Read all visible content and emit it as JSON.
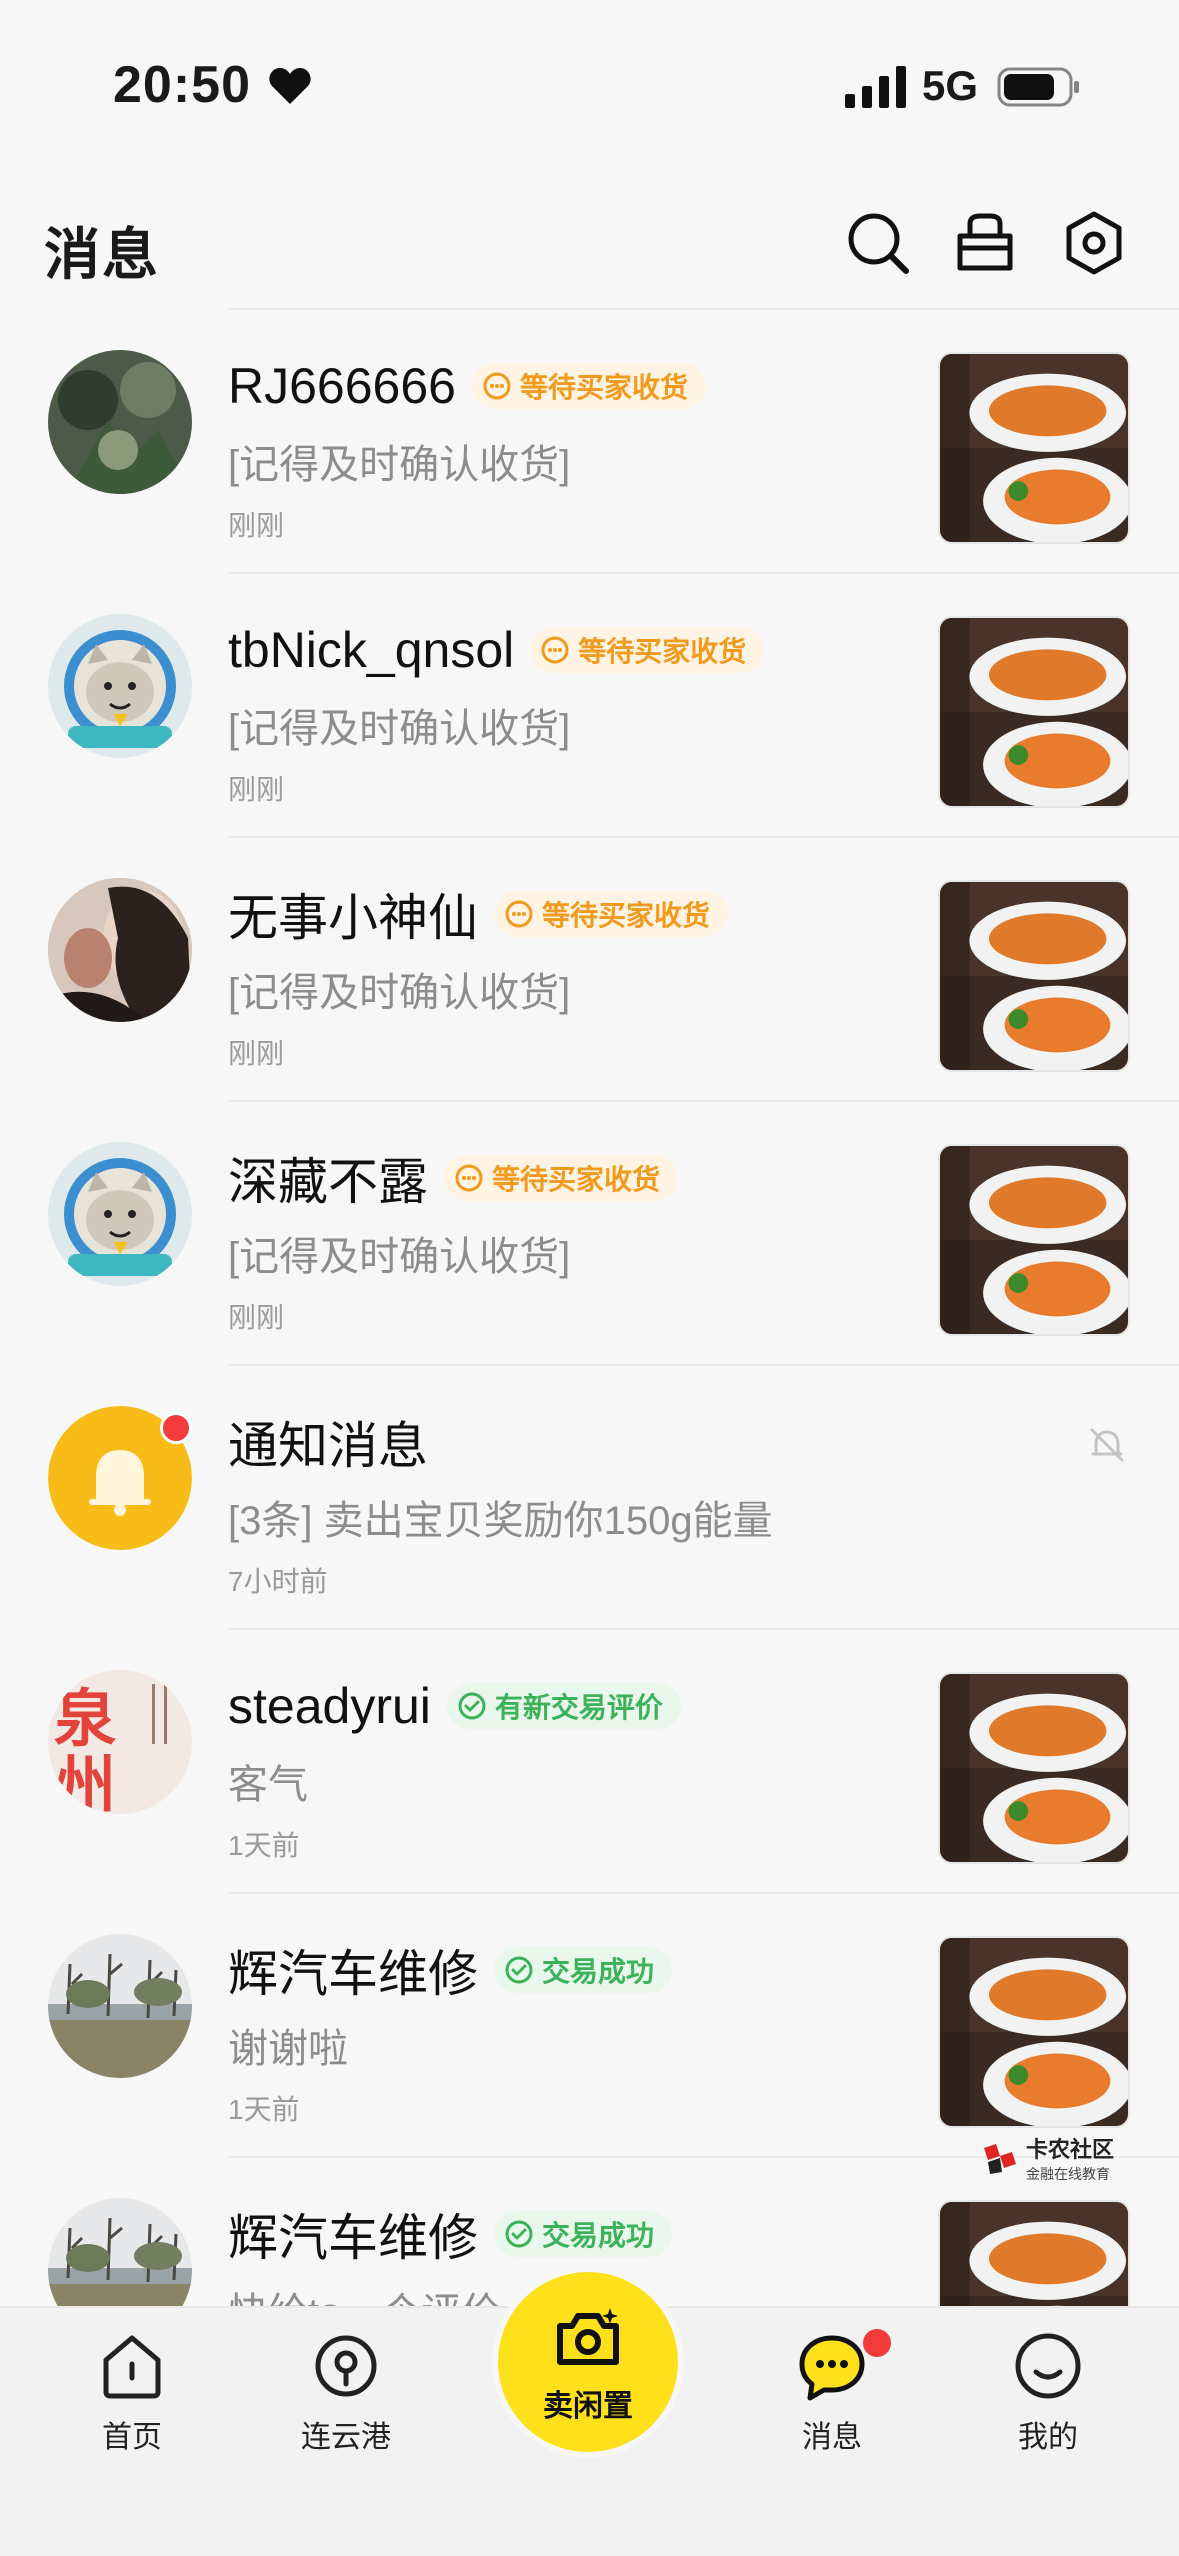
{
  "status_bar": {
    "time": "20:50",
    "network": "5G"
  },
  "header": {
    "title": "消息"
  },
  "messages": [
    {
      "name": "RJ666666",
      "tag": "等待买家收货",
      "tag_color": "orange",
      "preview": "[记得及时确认收货]",
      "time": "刚刚"
    },
    {
      "name": "tbNick_qnsol",
      "tag": "等待买家收货",
      "tag_color": "orange",
      "preview": "[记得及时确认收货]",
      "time": "刚刚"
    },
    {
      "name": "无事小神仙",
      "tag": "等待买家收货",
      "tag_color": "orange",
      "preview": "[记得及时确认收货]",
      "time": "刚刚"
    },
    {
      "name": "深藏不露",
      "tag": "等待买家收货",
      "tag_color": "orange",
      "preview": "[记得及时确认收货]",
      "time": "刚刚"
    },
    {
      "name": "通知消息",
      "tag": "",
      "preview": "[3条] 卖出宝贝奖励你150g能量",
      "time": "7小时前"
    },
    {
      "name": "steadyrui",
      "tag": "有新交易评价",
      "tag_color": "green",
      "preview": "客气",
      "time": "1天前",
      "avatar_text": "泉州"
    },
    {
      "name": "辉汽车维修",
      "tag": "交易成功",
      "tag_color": "green",
      "preview": "谢谢啦",
      "time": "1天前"
    },
    {
      "name": "辉汽车维修",
      "tag": "交易成功",
      "tag_color": "green",
      "preview": "快给ta一个评价",
      "time": ""
    }
  ],
  "nav": {
    "home": "首页",
    "city": "连云港",
    "sell": "卖闲置",
    "messages": "消息",
    "mine": "我的"
  },
  "watermark": {
    "title": "卡农社区",
    "subtitle": "金融在线教育"
  },
  "colors": {
    "accent_yellow": "#ffe11b",
    "tag_orange": "#f29a1c",
    "tag_green": "#3cb35a",
    "badge_red": "#f23c3c"
  }
}
